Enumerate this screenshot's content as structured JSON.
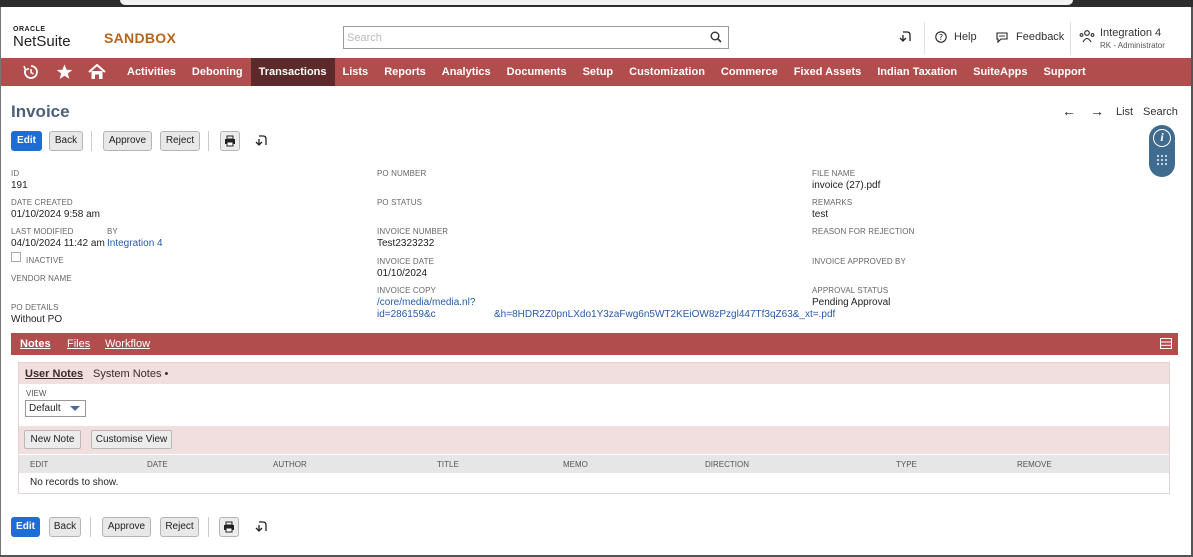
{
  "header": {
    "logo_oracle": "ORACLE",
    "logo_netsuite": "NetSuite",
    "env": "SANDBOX",
    "search_placeholder": "Search",
    "help": "Help",
    "feedback": "Feedback",
    "user_name": "Integration 4",
    "user_role": "RK - Administrator"
  },
  "nav": {
    "items": [
      "Activities",
      "Deboning",
      "Transactions",
      "Lists",
      "Reports",
      "Analytics",
      "Documents",
      "Setup",
      "Customization",
      "Commerce",
      "Fixed Assets",
      "Indian Taxation",
      "SuiteApps",
      "Support"
    ],
    "active": "Transactions"
  },
  "page": {
    "title": "Invoice",
    "list": "List",
    "search": "Search"
  },
  "toolbar": {
    "edit": "Edit",
    "back": "Back",
    "approve": "Approve",
    "reject": "Reject"
  },
  "fields": {
    "id_label": "ID",
    "id_value": "191",
    "date_created_label": "DATE CREATED",
    "date_created_value": "01/10/2024 9:58 am",
    "last_modified_label": "LAST MODIFIED",
    "last_modified_value": "04/10/2024 11:42 am",
    "by_label": "BY",
    "by_value": "Integration 4",
    "inactive_label": "INACTIVE",
    "vendor_name_label": "VENDOR NAME",
    "po_details_label": "PO DETAILS",
    "po_details_value": "Without PO",
    "po_number_label": "PO NUMBER",
    "po_status_label": "PO STATUS",
    "invoice_number_label": "INVOICE NUMBER",
    "invoice_number_value": "Test2323232",
    "invoice_date_label": "INVOICE DATE",
    "invoice_date_value": "01/10/2024",
    "invoice_copy_label": "INVOICE COPY",
    "invoice_copy_line1": "/core/media/media.nl?",
    "invoice_copy_line2": "id=286159&c",
    "invoice_copy_line3": "&h=8HDR2Z0pnLXdo1Y3zaFwg6n5WT2KEiOW8zPzgl447Tf3qZ63&_xt=.pdf",
    "file_name_label": "FILE NAME",
    "file_name_value": "invoice (27).pdf",
    "remarks_label": "REMARKS",
    "remarks_value": "test",
    "reason_label": "REASON FOR REJECTION",
    "approved_by_label": "INVOICE APPROVED BY",
    "approval_status_label": "APPROVAL STATUS",
    "approval_status_value": "Pending Approval"
  },
  "tabs": {
    "notes": "Notes",
    "files": "Files",
    "workflow": "Workflow"
  },
  "notes": {
    "user_notes": "User Notes",
    "system_notes": "System Notes •",
    "view_label": "VIEW",
    "view_value": "Default",
    "new_note": "New Note",
    "customise_view": "Customise View",
    "columns": [
      "EDIT",
      "DATE",
      "AUTHOR",
      "TITLE",
      "MEMO",
      "DIRECTION",
      "TYPE",
      "REMOVE"
    ],
    "empty": "No records to show."
  },
  "colors": {
    "nav": "#b24d4d",
    "nav_active": "#5c2a2a",
    "primary": "#1c6ed6",
    "title": "#4d5f79"
  }
}
